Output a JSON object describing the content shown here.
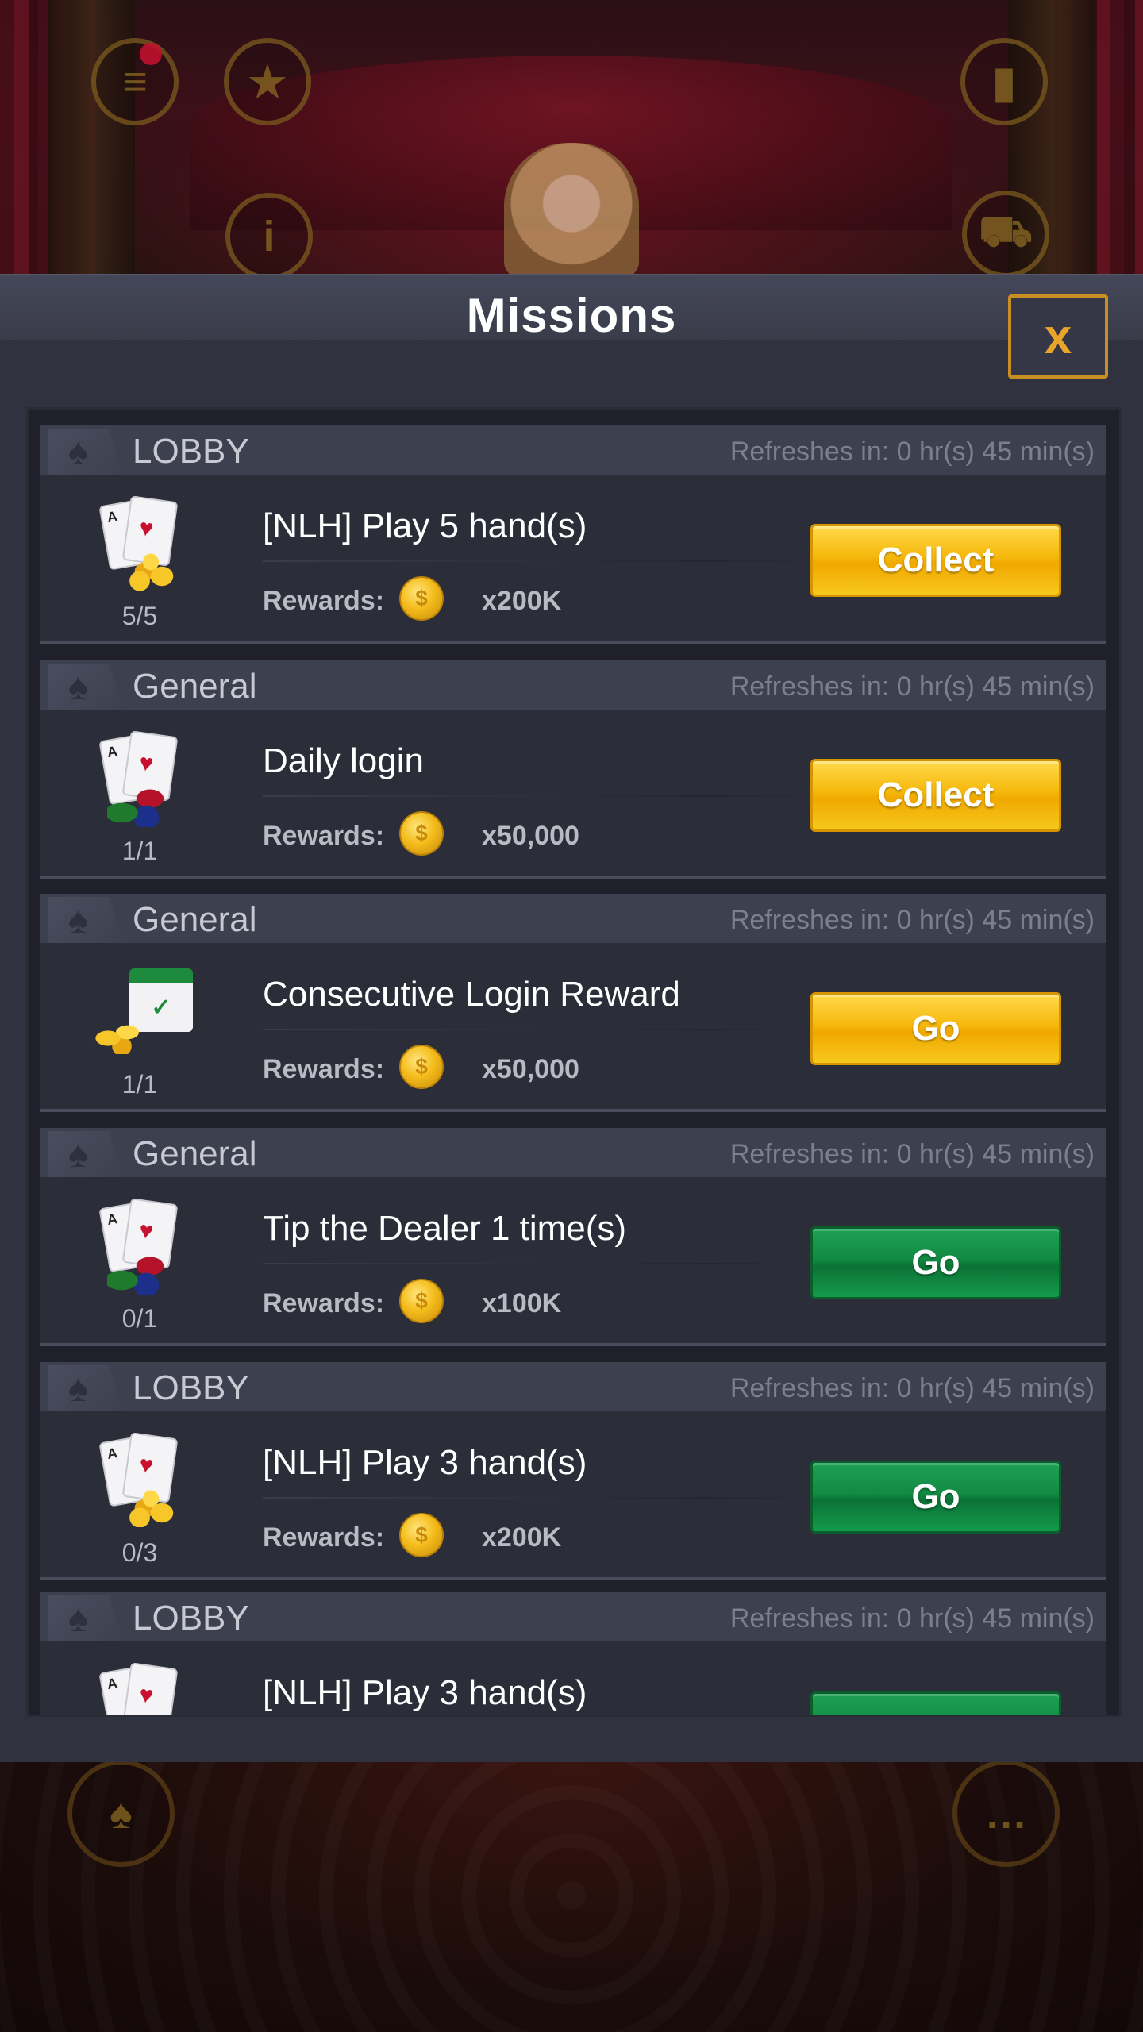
{
  "background": {
    "hud_top": [
      "menu-icon",
      "bookmark-icon",
      "stats-icon",
      "info-icon",
      "cart-icon"
    ],
    "hud_bottom": [
      "cards-icon",
      "chat-icon"
    ]
  },
  "modal": {
    "title": "Missions",
    "close_label": "x"
  },
  "colors": {
    "collect_button": "#f5b80c",
    "go_button": "#128a44",
    "panel": "#30323f",
    "close_border": "#c98e22"
  },
  "missions": [
    {
      "category": "LOBBY",
      "refresh": "Refreshes in: 0 hr(s) 45 min(s)",
      "title": "[NLH] Play 5 hand(s)",
      "rewards_label": "Rewards:",
      "reward": "x200K",
      "progress": "5/5",
      "button": "Collect",
      "icon": "cards-coins-icon"
    },
    {
      "category": "General",
      "refresh": "Refreshes in: 0 hr(s) 45 min(s)",
      "title": "Daily login",
      "rewards_label": "Rewards:",
      "reward": "x50,000",
      "progress": "1/1",
      "button": "Collect",
      "icon": "cards-chips-icon"
    },
    {
      "category": "General",
      "refresh": "Refreshes in: 0 hr(s) 45 min(s)",
      "title": "Consecutive Login Reward",
      "rewards_label": "Rewards:",
      "reward": "x50,000",
      "progress": "1/1",
      "button": "Go",
      "icon": "calendar-coins-icon"
    },
    {
      "category": "General",
      "refresh": "Refreshes in: 0 hr(s) 45 min(s)",
      "title": "Tip the Dealer 1 time(s)",
      "rewards_label": "Rewards:",
      "reward": "x100K",
      "progress": "0/1",
      "button": "Go",
      "icon": "cards-chips-icon"
    },
    {
      "category": "LOBBY",
      "refresh": "Refreshes in: 0 hr(s) 45 min(s)",
      "title": "[NLH] Play 3 hand(s)",
      "rewards_label": "Rewards:",
      "reward": "x200K",
      "progress": "0/3",
      "button": "Go",
      "icon": "cards-coins-icon"
    },
    {
      "category": "LOBBY",
      "refresh": "Refreshes in: 0 hr(s) 45 min(s)",
      "title": "[NLH] Play 3 hand(s)",
      "icon": "cards-coins-icon"
    }
  ]
}
